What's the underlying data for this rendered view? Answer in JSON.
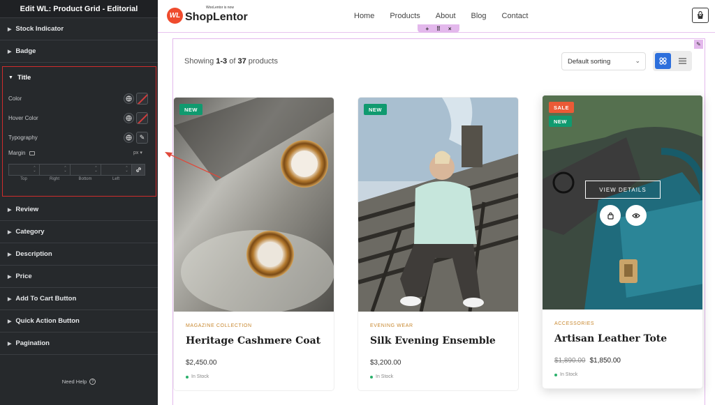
{
  "panel": {
    "header": "Edit WL: Product Grid - Editorial",
    "sections_before": [
      {
        "label": "Stock Indicator"
      },
      {
        "label": "Badge"
      }
    ],
    "title_section": {
      "label": "Title",
      "color_label": "Color",
      "hover_color_label": "Hover Color",
      "typography_label": "Typography",
      "margin_label": "Margin",
      "unit": "px",
      "margin_fields": [
        "Top",
        "Right",
        "Bottom",
        "Left"
      ]
    },
    "sections_after": [
      {
        "label": "Review"
      },
      {
        "label": "Category"
      },
      {
        "label": "Description"
      },
      {
        "label": "Price"
      },
      {
        "label": "Add To Cart Button"
      },
      {
        "label": "Quick Action Button"
      },
      {
        "label": "Pagination"
      }
    ],
    "help": "Need Help"
  },
  "site": {
    "logo_tagline": "WooLentor is now",
    "logo_badge": "WL",
    "logo_name_a": "Shop",
    "logo_name_b": "Lentor",
    "nav": [
      "Home",
      "Products",
      "About",
      "Blog",
      "Contact"
    ],
    "cart_count": "0"
  },
  "toolbar": {
    "showing_prefix": "Showing",
    "showing_range": "1-3",
    "showing_of": "of",
    "showing_total": "37",
    "showing_suffix": "products",
    "sort_value": "Default sorting"
  },
  "products": [
    {
      "badges": [
        "NEW"
      ],
      "category": "MAGAZINE COLLECTION",
      "name": "Heritage Cashmere Coat",
      "price": "$2,450.00",
      "old_price": "",
      "stock": "In Stock"
    },
    {
      "badges": [
        "NEW"
      ],
      "category": "EVENING WEAR",
      "name": "Silk Evening Ensemble",
      "price": "$3,200.00",
      "old_price": "",
      "stock": "In Stock"
    },
    {
      "badges": [
        "SALE",
        "NEW"
      ],
      "category": "ACCESSORIES",
      "name": "Artisan Leather Tote",
      "price": "$1,850.00",
      "old_price": "$1,890.00",
      "stock": "In Stock",
      "hover_label": "VIEW DETAILS"
    }
  ],
  "colors": {
    "accent_blue": "#2d6fdc",
    "badge_new": "#109a6f",
    "badge_sale": "#ea5a36",
    "category": "#c8882f",
    "highlight_red": "#d02c2c"
  }
}
